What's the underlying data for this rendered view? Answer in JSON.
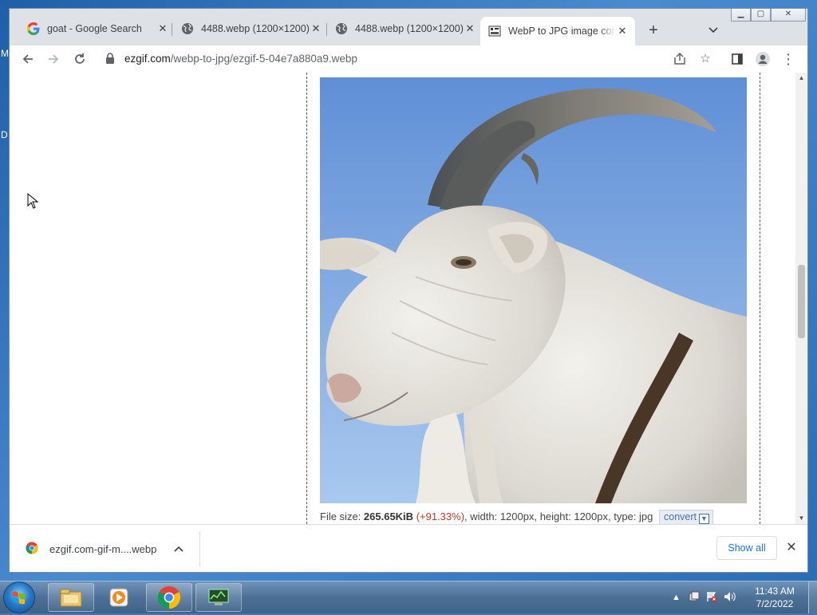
{
  "browser": {
    "tabs": [
      {
        "title": "goat - Google Search",
        "favicon": "google-icon"
      },
      {
        "title": "4488.webp (1200×1200)",
        "favicon": "globe-icon"
      },
      {
        "title": "4488.webp (1200×1200)",
        "favicon": "globe-icon"
      },
      {
        "title": "WebP to JPG image converter",
        "favicon": "ezgif-icon",
        "active": true
      }
    ],
    "url_host": "ezgif.com",
    "url_path": "/webp-to-jpg/ezgif-5-04e7a880a9.webp"
  },
  "page": {
    "file_info": {
      "label": "File size: ",
      "size": "265.65KiB",
      "pct": "(+91.33%)",
      "rest": ", width: 1200px, height: 1200px, type: jpg",
      "convert": "convert"
    }
  },
  "downloads": {
    "file": "ezgif.com-gif-m....webp",
    "show_all": "Show all"
  },
  "taskbar": {
    "time": "11:43 AM",
    "date": "7/2/2022"
  },
  "desktop": {
    "glyph_top": "M",
    "glyph_mid": "D"
  }
}
